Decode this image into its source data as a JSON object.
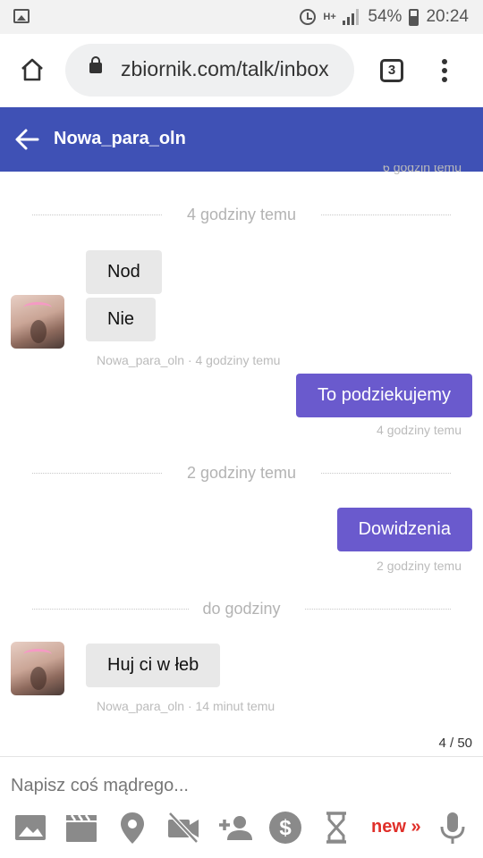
{
  "status_bar": {
    "network": "H+",
    "battery": "54%",
    "time": "20:24"
  },
  "browser": {
    "url": "zbiornik.com/talk/inbox",
    "tab_count": "3"
  },
  "conversation": {
    "title": "Nowa_para_oln"
  },
  "chat": {
    "clipped_time": "6 godzin temu",
    "groups": [
      {
        "divider": "4 godziny temu",
        "incoming_1": "Nod",
        "incoming_2": "Nie",
        "incoming_meta": "Nowa_para_oln · 4 godziny temu",
        "outgoing": "To podziekujemy",
        "outgoing_meta": "4 godziny temu"
      },
      {
        "divider": "2 godziny temu",
        "outgoing": "Dowidzenia",
        "outgoing_meta": "2 godziny temu"
      },
      {
        "divider": "do godziny",
        "incoming_1": "Huj ci w łeb",
        "incoming_meta": "Nowa_para_oln · 14 minut temu"
      }
    ],
    "counter": "4 / 50"
  },
  "composer": {
    "placeholder": "Napisz coś mądrego...",
    "new_label": "new »",
    "icons": [
      "image-icon",
      "video-icon",
      "location-pin-icon",
      "no-camera-icon",
      "add-person-icon",
      "dollar-icon",
      "hourglass-icon",
      "microphone-icon"
    ]
  },
  "colors": {
    "header": "#3f51b5",
    "outgoing_bubble": "#6a5acd",
    "incoming_bubble": "#e8e8e8",
    "new_label": "#e0302a",
    "toolbar_icon": "#8a8a8a"
  }
}
